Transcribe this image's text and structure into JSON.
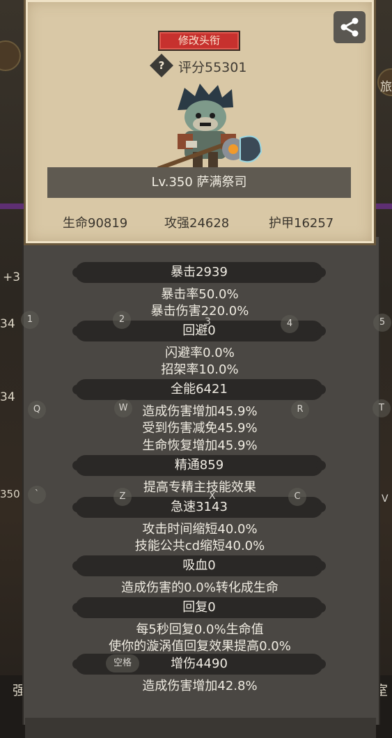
{
  "card": {
    "title_button": "修改头衔",
    "score": "评分55301",
    "level_name": "Lv.350 萨满祭司",
    "stats": [
      "生命90819",
      "攻强24628",
      "护甲16257"
    ]
  },
  "attributes": [
    {
      "name": "暴击2939",
      "details": [
        "暴击率50.0%",
        "暴击伤害220.0%"
      ]
    },
    {
      "name": "回避0",
      "details": [
        "闪避率0.0%",
        "招架率10.0%"
      ]
    },
    {
      "name": "全能6421",
      "details": [
        "造成伤害增加45.9%",
        "受到伤害减免45.9%",
        "生命恢复增加45.9%"
      ]
    },
    {
      "name": "精通859",
      "details": [
        "提高专精主技能效果"
      ]
    },
    {
      "name": "急速3143",
      "details": [
        "攻击时间缩短40.0%",
        "技能公共cd缩短40.0%"
      ]
    },
    {
      "name": "吸血0",
      "details": [
        "造成伤害的0.0%转化成生命"
      ]
    },
    {
      "name": "回复0",
      "details": [
        "每5秒回复0.0%生命值",
        "使你的漩涡值回复效果提高0.0%"
      ]
    },
    {
      "name": "增伤4490",
      "details": [
        "造成伤害增加42.8%"
      ]
    }
  ],
  "keyboard_hints": {
    "k1": "1",
    "k2": "2",
    "k3": "3",
    "k4": "4",
    "k5": "5",
    "kq": "Q",
    "kw": "W",
    "kr": "R",
    "kt": "T",
    "kbacktick": "`",
    "kz": "Z",
    "kx": "X",
    "kc": "C",
    "kv": "V",
    "kspace": "空格"
  },
  "background": {
    "left_texts": [
      "+3",
      "34",
      "34",
      "350"
    ],
    "right_texts": [
      "旅"
    ],
    "bottom_left": "强",
    "bottom_right": "室"
  },
  "colors": {
    "parchment": "#d9c8a6",
    "panel": "#4a4743",
    "title_button": "#c7312e",
    "pill": "#2a2826"
  }
}
